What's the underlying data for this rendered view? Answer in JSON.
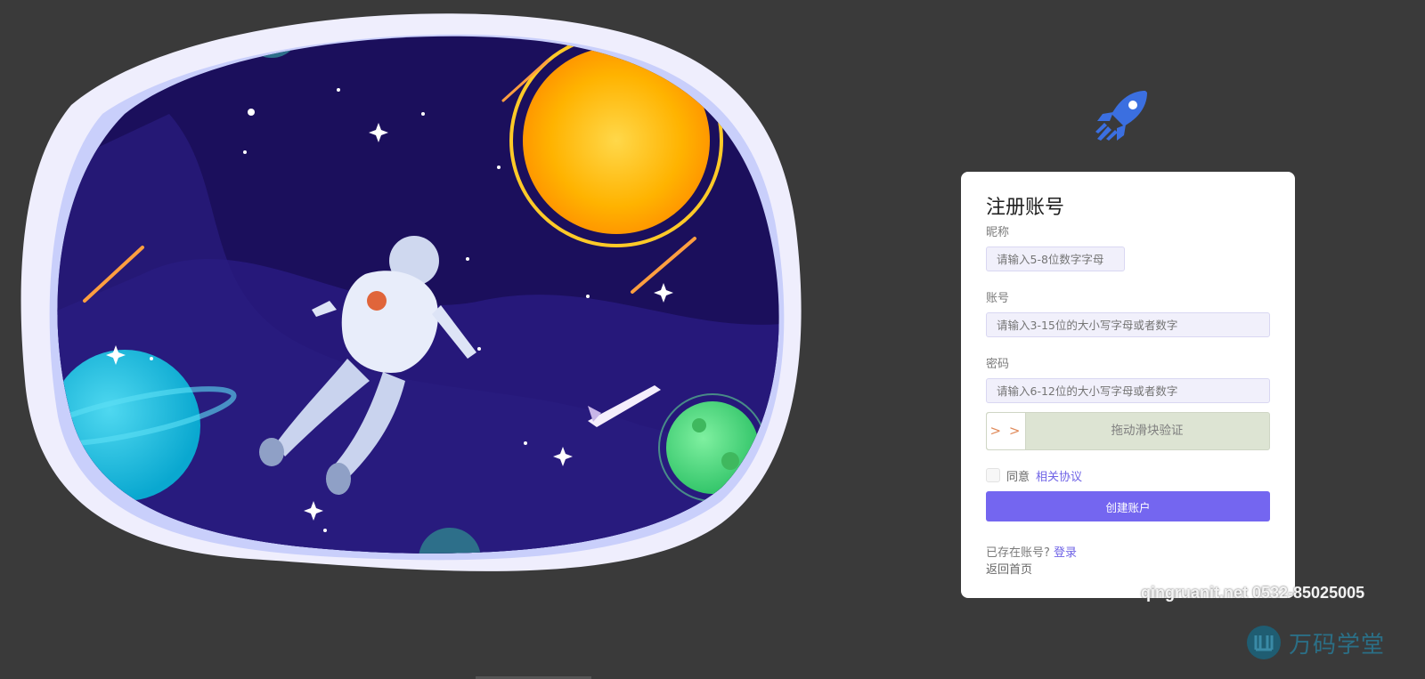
{
  "form": {
    "title": "注册账号",
    "nickname": {
      "label": "昵称",
      "placeholder": "请输入5-8位数字字母"
    },
    "account": {
      "label": "账号",
      "placeholder": "请输入3-15位的大小写字母或者数字"
    },
    "password": {
      "label": "密码",
      "placeholder": "请输入6-12位的大小写字母或者数字"
    },
    "slider": {
      "handle": "> >",
      "text": "拖动滑块验证"
    },
    "agree": {
      "text": "同意",
      "link": "相关协议"
    },
    "submit_label": "创建账户",
    "existing": {
      "text": "已存在账号?",
      "link": "登录"
    },
    "back_label": "返回首页"
  },
  "watermark": {
    "contact": "qingruanit.net 0532-85025005",
    "brand": "万码学堂"
  },
  "colors": {
    "background": "#3a3a3a",
    "accent": "#7466f0",
    "link": "#6f63e6",
    "rocket": "#3b6fe0"
  },
  "icons": {
    "logo": "rocket-icon",
    "brand": "wanma-logo-icon"
  }
}
